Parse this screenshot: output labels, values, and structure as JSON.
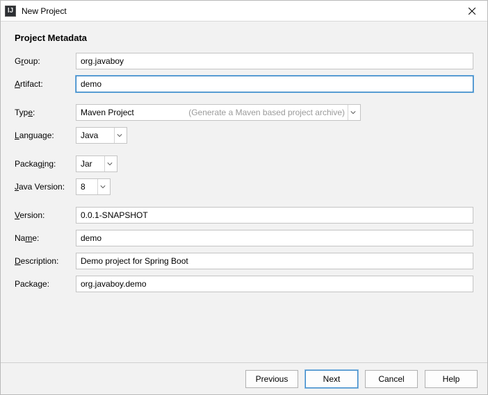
{
  "window": {
    "title": "New Project"
  },
  "section": {
    "title": "Project Metadata"
  },
  "labels": {
    "group_pre": "G",
    "group_ul": "r",
    "group_post": "oup:",
    "artifact_ul": "A",
    "artifact_post": "rtifact:",
    "type_pre": "Typ",
    "type_ul": "e",
    "type_post": ":",
    "language_ul": "L",
    "language_post": "anguage:",
    "packaging_pre": "Packag",
    "packaging_ul": "i",
    "packaging_post": "ng:",
    "java_ul": "J",
    "java_post": "ava Version:",
    "version_ul": "V",
    "version_post": "ersion:",
    "name_pre": "Na",
    "name_ul": "m",
    "name_post": "e:",
    "description_ul": "D",
    "description_post": "escription:",
    "package_pre": "Packa",
    "package_ul": "g",
    "package_post": "e:"
  },
  "fields": {
    "group": "org.javaboy",
    "artifact": "demo",
    "type_value": "Maven Project",
    "type_hint": "(Generate a Maven based project archive)",
    "language": "Java",
    "packaging": "Jar",
    "java_version": "8",
    "version": "0.0.1-SNAPSHOT",
    "name": "demo",
    "description": "Demo project for Spring Boot",
    "package": "org.javaboy.demo"
  },
  "buttons": {
    "previous": "Previous",
    "next": "Next",
    "cancel": "Cancel",
    "help": "Help"
  }
}
